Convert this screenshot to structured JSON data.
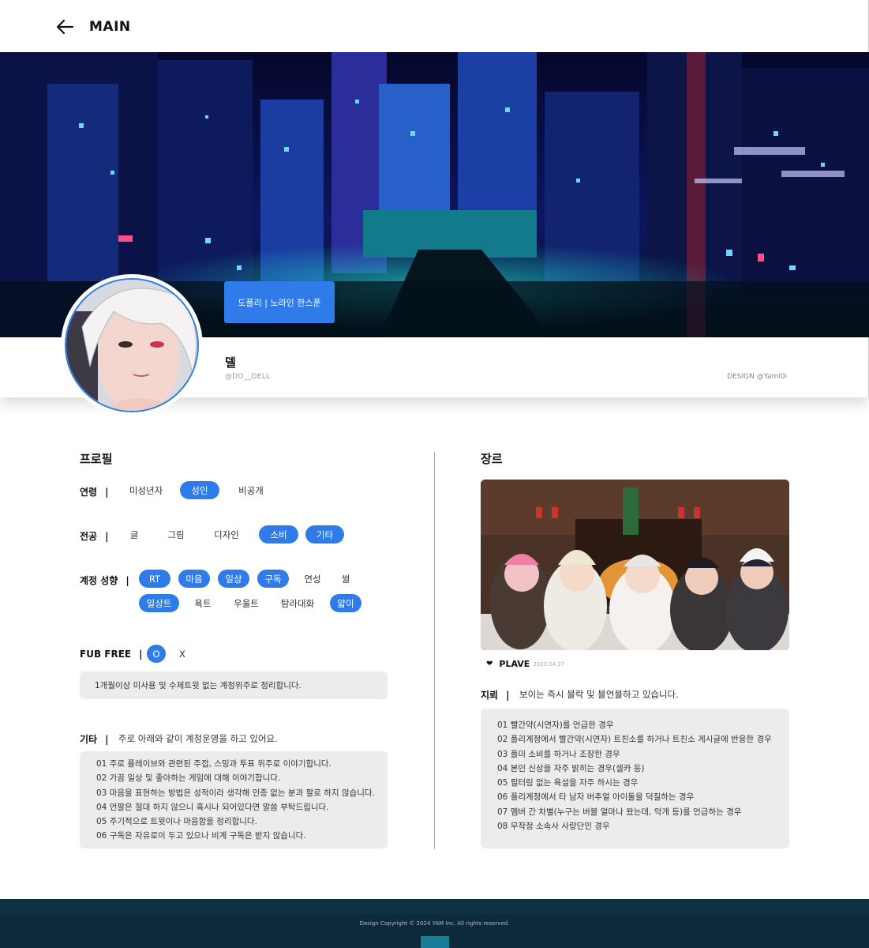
{
  "topbar": {
    "title": "MAIN"
  },
  "banner": {
    "tag": "도플리 | 노라인 한스푼"
  },
  "profile": {
    "name": "델",
    "handle": "@DO__DELL",
    "credit": "DESIGN @Yami0i"
  },
  "left": {
    "title": "프로필",
    "age": {
      "label": "연령",
      "options": [
        "미성년자",
        "성인",
        "비공개"
      ],
      "selected": [
        "성인"
      ]
    },
    "major": {
      "label": "전공",
      "options": [
        "글",
        "그림",
        "디자인",
        "소비",
        "기타"
      ],
      "selected": [
        "소비",
        "기타"
      ]
    },
    "tendency": {
      "label": "계정 성향",
      "options": [
        "RT",
        "마음",
        "일상",
        "구독",
        "연성",
        "썰",
        "일상트",
        "욕트",
        "우울트",
        "탐라대화",
        "얇이"
      ],
      "selected": [
        "RT",
        "마음",
        "일상",
        "구독",
        "일상트",
        "얇이"
      ]
    },
    "fubfree": {
      "label": "FUB FREE",
      "options": [
        "O",
        "X"
      ],
      "selected": [
        "O"
      ],
      "note": "1개월이상 미사용 및 수제트윗 없는 계정위주로 정리합니다."
    },
    "etc": {
      "label": "기타",
      "summary": "주로 아래와 같이 계정운영을 하고 있어요.",
      "lines": [
        "01 주로 플레이브와 관련된 주접, 스밍과 투표 위주로 이야기합니다.",
        "02 가끔 일상 및 좋아하는 게임에 대해 이야기합니다.",
        "03 마음을 표현하는 방법은 성적이라 생각해 인증 없는 분과 팔로 하지 않습니다.",
        "04 언팔은 절대 하지 않으니 혹시나 되어있다면 말씀 부탁드립니다.",
        "05 주기적으로 트윗이나 마음함을 정리합니다.",
        "06 구독은 자유로이 두고 있으나 비계 구독은 받지 않습니다."
      ]
    }
  },
  "right": {
    "title": "장르",
    "caption": {
      "name": "PLAVE",
      "date": "2023.04.27 -"
    },
    "landmine": {
      "label": "지뢰",
      "summary": "보이는 즉시 블락 및 블언블하고 있습니다.",
      "lines": [
        "01 빨간약(시연자)를 언급한 경우",
        "02 플리계정에서 빨간약(시연자) 트친소를 하거나 트친소 게시글에 반응한 경우",
        "03 플미 소비를 하거나 조장한 경우",
        "04 본인 신상을 자주 밝히는 경우(셀카 등)",
        "05 필터링 없는 욕설을 자주 하시는 경우",
        "06 플리계정에서 타 남자 버추얼 아이돌을 덕질하는 경우",
        "07 멤버 간 차별(누구는 버블 얼마나 왔는데, 악개 등)를 언급하는 경우",
        "08 무작정 소속사 사랑단인 경우"
      ]
    }
  },
  "footer": {
    "text": "Design Copyright © 2024 YAM Inc. All rights reserved."
  },
  "colors": {
    "accent": "#2f7bea",
    "note_bg": "#ececec",
    "footer_bg": "#0c2a3a"
  }
}
